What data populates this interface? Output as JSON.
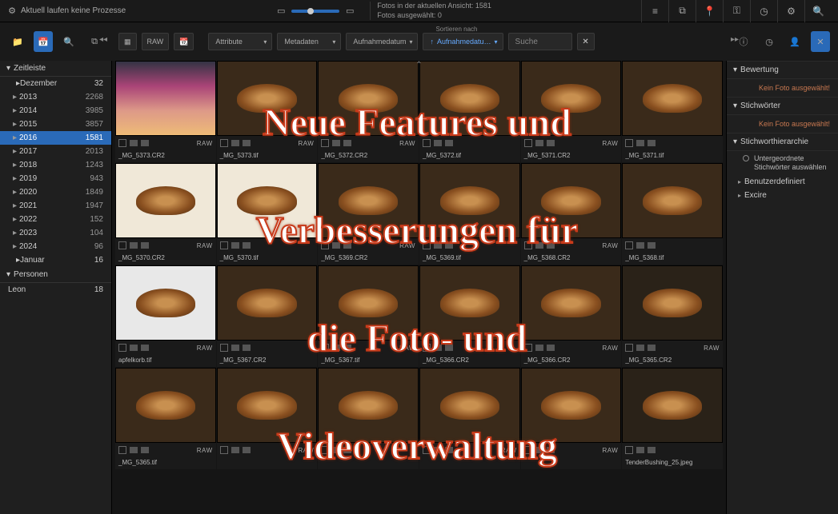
{
  "header": {
    "process_status": "Aktuell laufen keine Prozesse",
    "fotos_in_view": "Fotos in der aktuellen Ansicht: 1581",
    "selected": "Fotos ausgewählt: 0"
  },
  "filters": {
    "sort_label": "Sortieren nach",
    "raw_label": "RAW",
    "attribute": "Attribute",
    "metadaten": "Metadaten",
    "aufnahmedatum": "Aufnahmedatum",
    "aufnahmedatu_sort": "Aufnahmedatu…",
    "search_placeholder": "Suche"
  },
  "sidebar": {
    "zeitleiste": "Zeitleiste",
    "month": {
      "name": "Dezember",
      "count": "32"
    },
    "years": [
      {
        "y": "2013",
        "c": "2268"
      },
      {
        "y": "2014",
        "c": "3985"
      },
      {
        "y": "2015",
        "c": "3857"
      },
      {
        "y": "2016",
        "c": "1581"
      },
      {
        "y": "2017",
        "c": "2013"
      },
      {
        "y": "2018",
        "c": "1243"
      },
      {
        "y": "2019",
        "c": "943"
      },
      {
        "y": "2020",
        "c": "1849"
      },
      {
        "y": "2021",
        "c": "1947"
      },
      {
        "y": "2022",
        "c": "152"
      },
      {
        "y": "2023",
        "c": "104"
      },
      {
        "y": "2024",
        "c": "96"
      }
    ],
    "sub_month": {
      "name": "Januar",
      "count": "16"
    },
    "personen": "Personen",
    "person": {
      "name": "Leon",
      "count": "18"
    }
  },
  "right": {
    "bewertung": "Bewertung",
    "kein_foto": "Kein Foto ausgewählt!",
    "stichworter": "Stichwörter",
    "hierarchie": "Stichworthierarchie",
    "untergeordnete": "Untergeordnete Stichwörter auswählen",
    "benutzerdefiniert": "Benutzerdefiniert",
    "excire": "Excire"
  },
  "thumbs": [
    {
      "f": "_MG_5373.CR2",
      "r": true,
      "v": "sky"
    },
    {
      "f": "_MG_5373.tif",
      "r": true,
      "v": ""
    },
    {
      "f": "_MG_5372.CR2",
      "r": true,
      "v": ""
    },
    {
      "f": "_MG_5372.tif",
      "r": false,
      "v": ""
    },
    {
      "f": "_MG_5371.CR2",
      "r": true,
      "v": ""
    },
    {
      "f": "_MG_5371.tif",
      "r": false,
      "v": ""
    },
    {
      "f": "_MG_5370.CR2",
      "r": true,
      "v": "bright"
    },
    {
      "f": "_MG_5370.tif",
      "r": false,
      "v": "bright"
    },
    {
      "f": "_MG_5369.CR2",
      "r": true,
      "v": ""
    },
    {
      "f": "_MG_5369.tif",
      "r": false,
      "v": ""
    },
    {
      "f": "_MG_5368.CR2",
      "r": true,
      "v": ""
    },
    {
      "f": "_MG_5368.tif",
      "r": false,
      "v": ""
    },
    {
      "f": "apfelkorb.tif",
      "r": true,
      "v": "whiteb"
    },
    {
      "f": "_MG_5367.CR2",
      "r": false,
      "v": ""
    },
    {
      "f": "_MG_5367.tif",
      "r": true,
      "v": ""
    },
    {
      "f": "_MG_5366.CR2",
      "r": false,
      "v": ""
    },
    {
      "f": "_MG_5366.CR2",
      "r": true,
      "v": ""
    },
    {
      "f": "_MG_5365.CR2",
      "r": true,
      "v": "dark"
    },
    {
      "f": "_MG_5365.tif",
      "r": true,
      "v": ""
    },
    {
      "f": "",
      "r": true,
      "v": ""
    },
    {
      "f": "",
      "r": false,
      "v": ""
    },
    {
      "f": "",
      "r": true,
      "v": ""
    },
    {
      "f": "",
      "r": true,
      "v": ""
    },
    {
      "f": "TenderBushing_25.jpeg",
      "r": false,
      "v": "dark"
    }
  ],
  "overlay": {
    "l1": "Neue Features und",
    "l2": "Verbesserungen für",
    "l3": "die Foto- und",
    "l4": "Videoverwaltung"
  }
}
